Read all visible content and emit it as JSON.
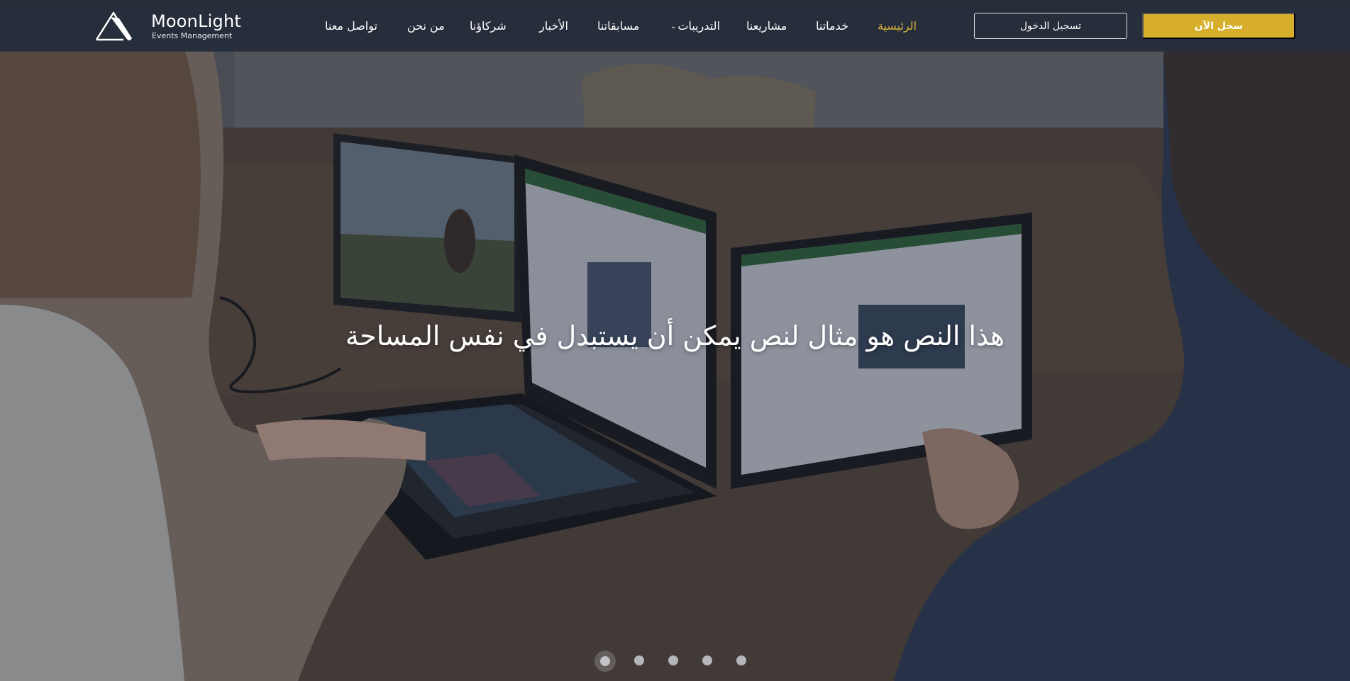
{
  "brand": {
    "name": "MoonLight",
    "tagline": "Events Management"
  },
  "nav": {
    "items": [
      {
        "label": "الرئيسية",
        "active": true
      },
      {
        "label": "خدماتنا",
        "active": false
      },
      {
        "label": "مشاريعنا",
        "active": false
      },
      {
        "label": "التدريبات",
        "active": false,
        "dropdown": true
      },
      {
        "label": "مسابقاتنا",
        "active": false
      },
      {
        "label": "الأخبار",
        "active": false
      },
      {
        "label": "شركاؤنا",
        "active": false
      },
      {
        "label": "من نحن",
        "active": false
      },
      {
        "label": "تواصل معنا",
        "active": false
      }
    ]
  },
  "auth": {
    "login_label": "تسجيل الدخول",
    "signup_label": "سجل الآن"
  },
  "hero": {
    "headline": "هذا النص هو مثال لنص يمكن أن يستبدل في نفس المساحة",
    "slides_total": 5,
    "active_slide": 1
  },
  "colors": {
    "accent": "#d6ae2c",
    "topbar": "#262d3a",
    "active_nav": "#d4b13a"
  },
  "icons": {
    "dropdown": "chevron-down-icon",
    "logo": "mountain-logo-icon"
  }
}
